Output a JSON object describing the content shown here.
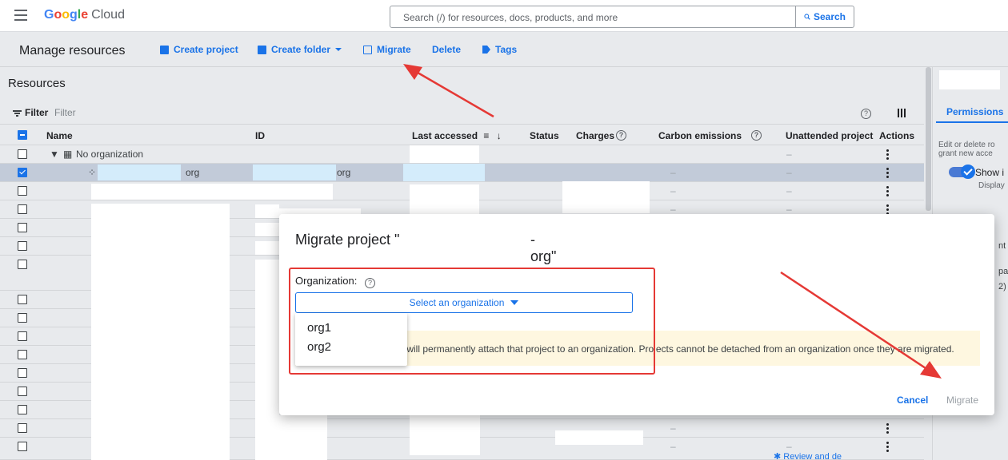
{
  "topbar": {
    "logo_g": "G",
    "logo_o1": "o",
    "logo_o2": "o",
    "logo_g2": "g",
    "logo_l": "l",
    "logo_e": "e",
    "logo_cloud": "Cloud",
    "search_placeholder": "Search (/) for resources, docs, products, and more",
    "search_button": "Search"
  },
  "header": {
    "title": "Manage resources",
    "create_project": "Create project",
    "create_folder": "Create folder",
    "migrate": "Migrate",
    "delete": "Delete",
    "tags": "Tags"
  },
  "resources": {
    "title": "Resources",
    "filter_label": "Filter",
    "filter_placeholder": "Filter"
  },
  "table": {
    "columns": [
      "Name",
      "ID",
      "Last accessed",
      "Status",
      "Charges",
      "Carbon emissions",
      "Unattended project",
      "Actions"
    ],
    "rows": [
      {
        "name": "No organization",
        "type": "org-node"
      },
      {
        "name_suffix": "org",
        "id_suffix": "org",
        "carbon": "–",
        "unattended": "–",
        "selected": true
      },
      {
        "carbon": "–",
        "unattended": "–"
      },
      {
        "carbon": "–",
        "unattended": "–"
      }
    ],
    "bottom_dash_carbon": "–",
    "bottom_dash_unattended": "–",
    "bottom_link": "Review and de"
  },
  "right_panel": {
    "tab": "Permissions",
    "desc_line1": "Edit or delete ro",
    "desc_line2": "grant new acce",
    "toggle_label": "Show i",
    "toggle_sub": "Display",
    "frag1": "nt",
    "frag2": "pa",
    "frag3": "2)"
  },
  "modal": {
    "title_prefix": "Migrate project \"",
    "title_suffix": "-org\"",
    "org_label": "Organization:",
    "select_placeholder": "Select an organization",
    "options": [
      "org1",
      "org2"
    ],
    "warning": "ect will permanently attach that project to an organization. Projects cannot be detached from an organization once they are migrated.",
    "cancel": "Cancel",
    "migrate": "Migrate"
  },
  "colors": {
    "accent": "#1a73e8",
    "annotation_red": "#e53935",
    "warning_bg": "#fef7e0"
  }
}
